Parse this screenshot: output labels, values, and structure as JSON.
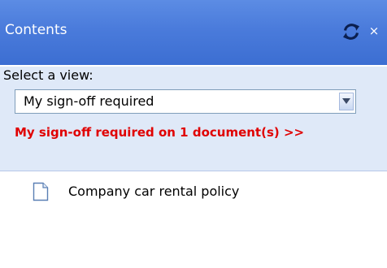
{
  "panel": {
    "title": "Contents",
    "refresh_icon": "refresh-icon",
    "close_label": "×"
  },
  "view_selector": {
    "label": "Select a view:",
    "selected": "My sign-off required",
    "signoff_link": "My sign-off required on 1 document(s) >>"
  },
  "documents": [
    {
      "icon": "document-icon",
      "label": "Company car rental policy"
    }
  ],
  "colors": {
    "titlebar": "#4a7bdb",
    "view_area": "#dfe9f8",
    "signoff_link": "#e00000"
  }
}
